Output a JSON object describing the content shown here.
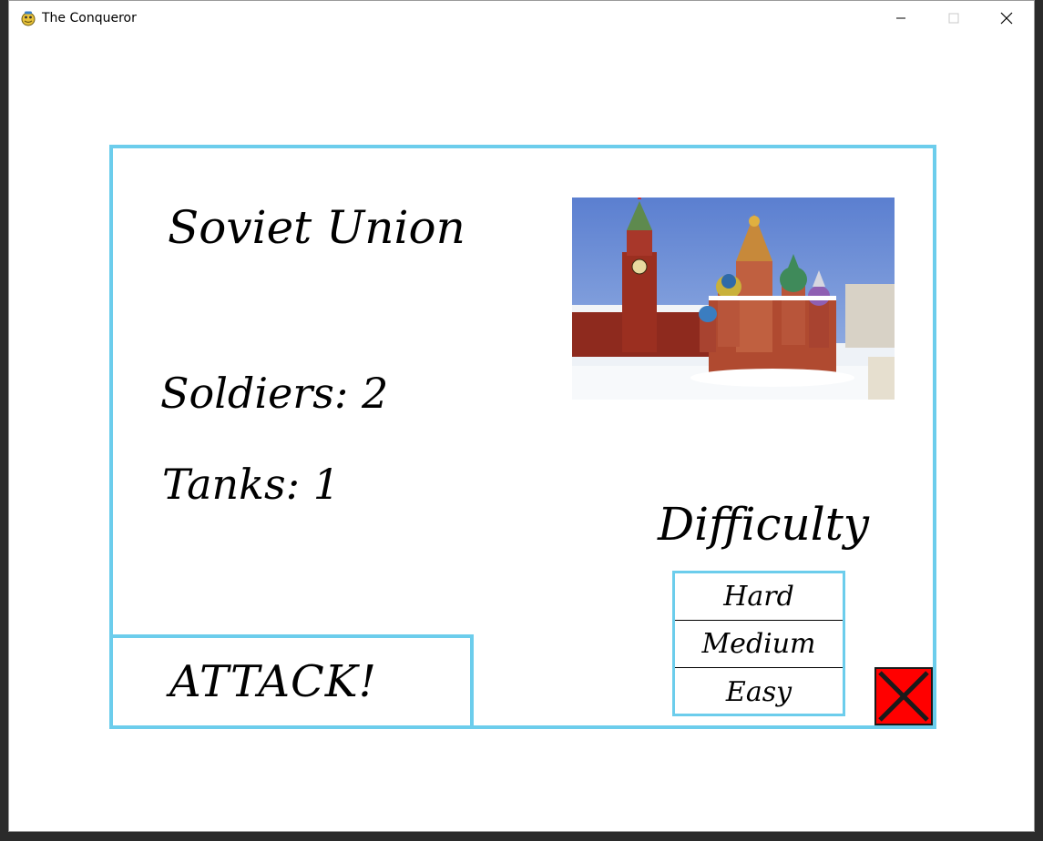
{
  "window": {
    "title": "The Conqueror",
    "icon": "pygame-snake-icon"
  },
  "game": {
    "country_name": "Soviet Union",
    "soldiers_text": "Soldiers: 2",
    "tanks_text": "Tanks: 1",
    "image_subject": "moscow-kremlin-image",
    "difficulty": {
      "label": "Difficulty",
      "options": [
        "Hard",
        "Medium",
        "Easy"
      ]
    },
    "attack_label": "ATTACK!",
    "close_icon": "close-x-icon"
  },
  "colors": {
    "accent_border": "#6ccdec",
    "close_button_bg": "#ff0000",
    "text": "#000000",
    "background": "#ffffff"
  }
}
